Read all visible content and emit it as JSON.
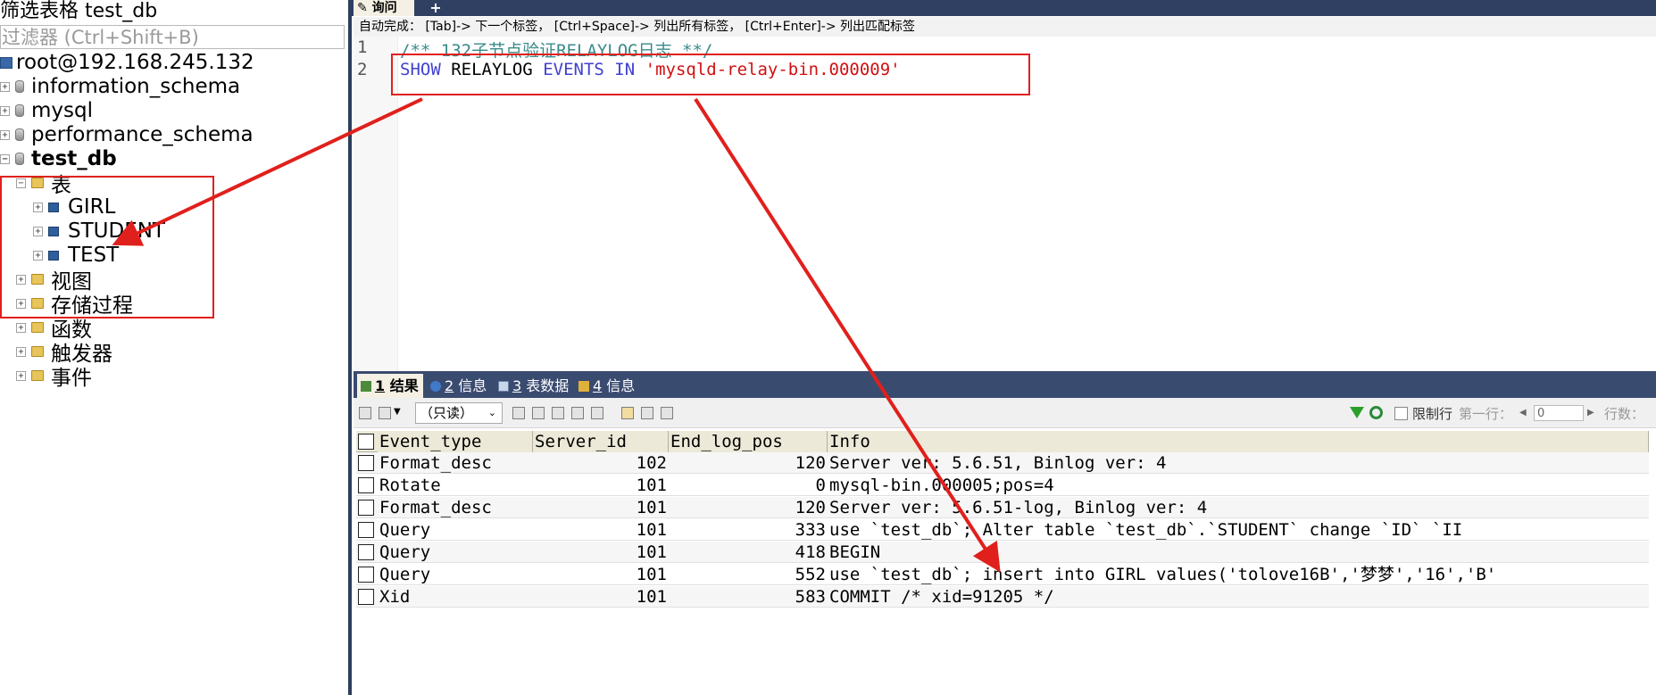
{
  "sidebar": {
    "filter_title": "筛选表格 test_db",
    "filter_placeholder": "过滤器 (Ctrl+Shift+B)",
    "tree": {
      "server": "root@192.168.245.132",
      "databases": [
        "information_schema",
        "mysql",
        "performance_schema"
      ],
      "current_db": "test_db",
      "tables_folder": "表",
      "tables": [
        "GIRL",
        "STUDENT",
        "TEST"
      ],
      "folders": [
        "视图",
        "存储过程",
        "函数",
        "触发器",
        "事件"
      ]
    }
  },
  "editor": {
    "tab_label": "询问",
    "add_tab_label": "+",
    "autocomplete_hint": "自动完成： [Tab]-> 下一个标签， [Ctrl+Space]-> 列出所有标签， [Ctrl+Enter]-> 列出匹配标签",
    "lines": {
      "n1": "1",
      "n2": "2",
      "comment": "/** 132子节点验证RELAYLOG日志 **/",
      "kw_show": "SHOW",
      "id_relaylog": "RELAYLOG",
      "kw_events": "EVENTS",
      "kw_in": "IN",
      "str_file": "'mysqld-relay-bin.000009'"
    }
  },
  "results": {
    "tabs": [
      {
        "num": "1",
        "label": "结果"
      },
      {
        "num": "2",
        "label": "信息"
      },
      {
        "num": "3",
        "label": "表数据"
      },
      {
        "num": "4",
        "label": "信息"
      }
    ],
    "readonly_label": "（只读）",
    "limit_label": "限制行",
    "first_row_label": "第一行：",
    "first_row_value": "0",
    "rows_label": "行数：",
    "columns": [
      "Event_type",
      "Server_id",
      "End_log_pos",
      "Info"
    ],
    "rows": [
      [
        "Format_desc",
        "102",
        "120",
        "Server ver: 5.6.51, Binlog ver: 4"
      ],
      [
        "Rotate",
        "101",
        "0",
        "mysql-bin.000005;pos=4"
      ],
      [
        "Format_desc",
        "101",
        "120",
        "Server ver: 5.6.51-log, Binlog ver: 4"
      ],
      [
        "Query",
        "101",
        "333",
        "use `test_db`; Alter table `test_db`.`STUDENT`     change `ID` `II"
      ],
      [
        "Query",
        "101",
        "418",
        "BEGIN"
      ],
      [
        "Query",
        "101",
        "552",
        "use `test_db`; insert into GIRL values('tolove16B','梦梦','16','B'"
      ],
      [
        "Xid",
        "101",
        "583",
        "COMMIT /* xid=91205 */"
      ]
    ]
  },
  "colors": {
    "annotation_red": "#e0201c",
    "keyword_blue": "#4040d0",
    "string_red": "#d01010",
    "comment_teal": "#3a8a8a",
    "panel_navy": "#3a4b70"
  }
}
